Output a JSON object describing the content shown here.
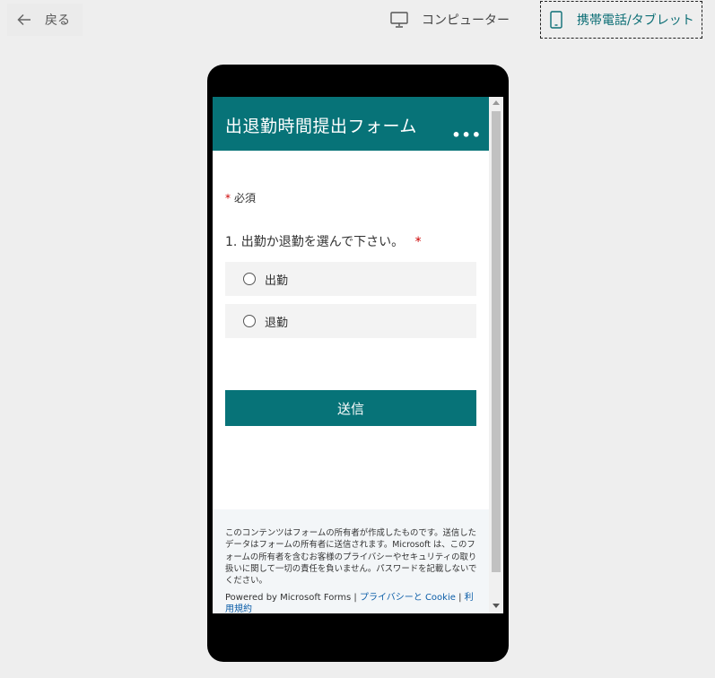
{
  "toolbar": {
    "back_label": "戻る",
    "computer_label": "コンピューター",
    "mobile_label": "携帯電話/タブレット"
  },
  "form": {
    "title": "出退勤時間提出フォーム",
    "more_icon": "more-dots-icon",
    "required_mark": "*",
    "required_label": "必須",
    "question": "1. 出勤か退勤を選んで下さい。",
    "question_required_mark": "*",
    "options": [
      {
        "label": "出勤"
      },
      {
        "label": "退勤"
      }
    ],
    "submit_label": "送信"
  },
  "footer": {
    "disclaimer": "このコンテンツはフォームの所有者が作成したものです。送信したデータはフォームの所有者に送信されます。Microsoft は、このフォームの所有者を含むお客様のプライバシーやセキュリティの取り扱いに関して一切の責任を負いません。パスワードを記載しないでください。",
    "powered_by": "Powered by Microsoft Forms |",
    "privacy_link": "プライバシーと Cookie",
    "separator": "|",
    "terms_link": "利用規約"
  },
  "colors": {
    "accent": "#077378",
    "background": "#eeeeee",
    "required": "#cc0000",
    "link": "#0c5ea8"
  }
}
